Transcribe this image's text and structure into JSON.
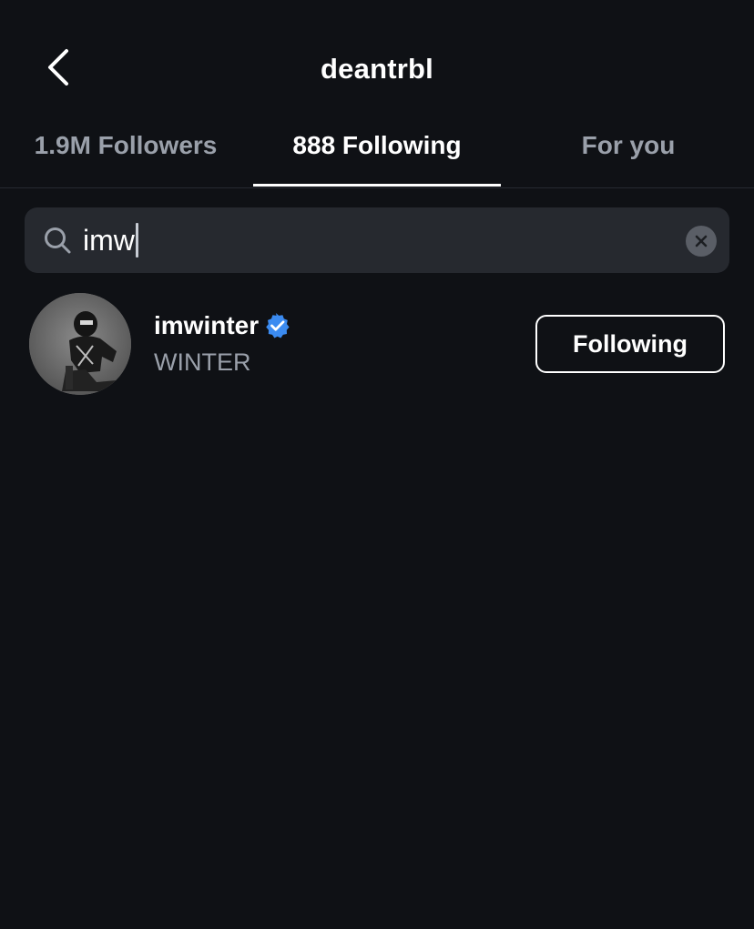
{
  "header": {
    "title": "deantrbl",
    "back_icon": "chevron-left-icon"
  },
  "tabs": [
    {
      "label": "1.9M Followers",
      "active": false
    },
    {
      "label": "888 Following",
      "active": true
    },
    {
      "label": "For you",
      "active": false
    }
  ],
  "search": {
    "value": "imw",
    "search_icon": "search-icon",
    "clear_icon": "clear-icon"
  },
  "results": [
    {
      "username": "imwinter",
      "verified": true,
      "display_name": "WINTER",
      "button_label": "Following"
    }
  ],
  "colors": {
    "background": "#0f1115",
    "search_background": "#26292f",
    "muted_text": "#9aa0aa",
    "verified_blue": "#3b8bf0"
  }
}
